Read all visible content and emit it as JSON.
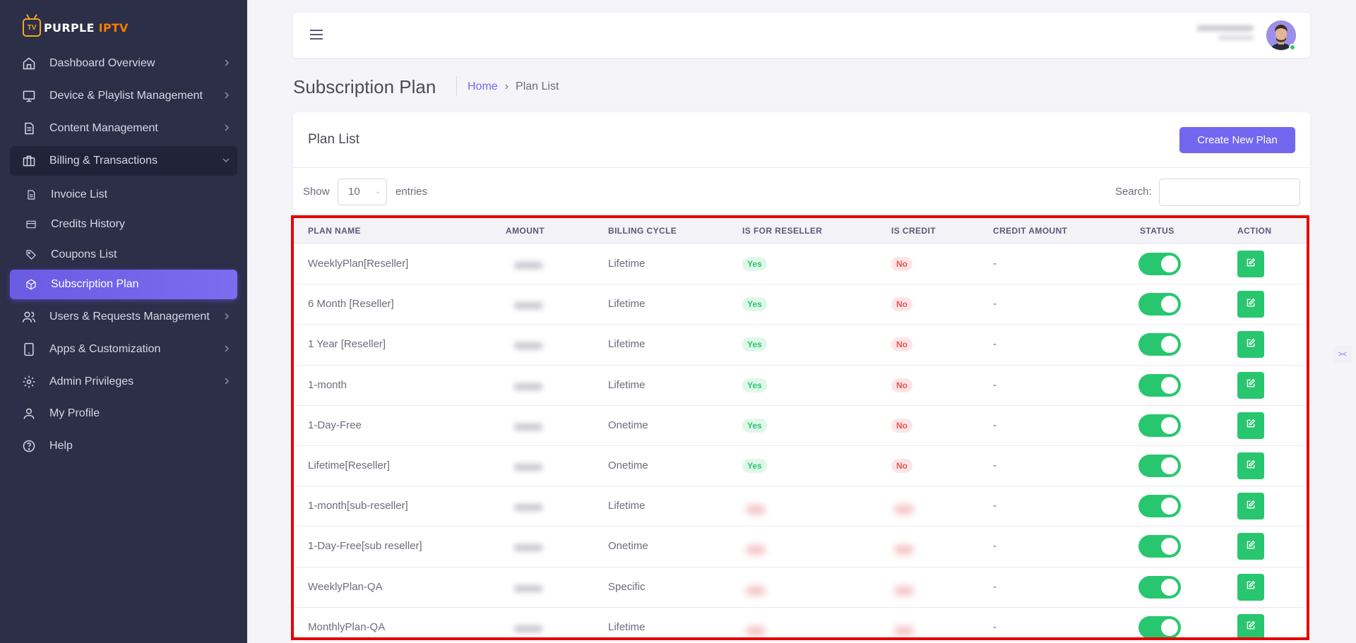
{
  "brand": {
    "name_part1": "PURPLE ",
    "name_part2": "IPTV",
    "badge": "TV"
  },
  "sidebar": {
    "items": [
      {
        "label": "Dashboard Overview",
        "icon": "home-icon"
      },
      {
        "label": "Device & Playlist Management",
        "icon": "monitor-icon"
      },
      {
        "label": "Content Management",
        "icon": "document-icon"
      },
      {
        "label": "Billing & Transactions",
        "icon": "briefcase-icon"
      },
      {
        "label": "Users & Requests Management",
        "icon": "users-icon"
      },
      {
        "label": "Apps & Customization",
        "icon": "tablet-icon"
      },
      {
        "label": "Admin Privileges",
        "icon": "gear-icon"
      },
      {
        "label": "My Profile",
        "icon": "user-icon"
      },
      {
        "label": "Help",
        "icon": "help-circle-icon"
      }
    ],
    "billing_subitems": [
      {
        "label": "Invoice List",
        "icon": "file-icon"
      },
      {
        "label": "Credits History",
        "icon": "credit-card-icon"
      },
      {
        "label": "Coupons List",
        "icon": "tag-icon"
      },
      {
        "label": "Subscription Plan",
        "icon": "box-icon"
      }
    ]
  },
  "page": {
    "title": "Subscription Plan",
    "breadcrumb_home": "Home",
    "breadcrumb_separator": "›",
    "breadcrumb_current": "Plan List"
  },
  "card": {
    "title": "Plan List",
    "create_button": "Create New Plan",
    "show_label": "Show",
    "entries_value": "10",
    "entries_label": "entries",
    "search_label": "Search:"
  },
  "table": {
    "columns": [
      "PLAN NAME",
      "AMOUNT",
      "BILLING CYCLE",
      "IS FOR RESELLER",
      "IS CREDIT",
      "CREDIT AMOUNT",
      "STATUS",
      "ACTION"
    ],
    "rows": [
      {
        "name": "WeeklyPlan[Reseller]",
        "cycle": "Lifetime",
        "reseller": "Yes",
        "credit": "No",
        "credit_amount": "-",
        "status_on": true
      },
      {
        "name": "6 Month [Reseller]",
        "cycle": "Lifetime",
        "reseller": "Yes",
        "credit": "No",
        "credit_amount": "-",
        "status_on": true
      },
      {
        "name": "1 Year [Reseller]",
        "cycle": "Lifetime",
        "reseller": "Yes",
        "credit": "No",
        "credit_amount": "-",
        "status_on": true
      },
      {
        "name": "1-month",
        "cycle": "Lifetime",
        "reseller": "Yes",
        "credit": "No",
        "credit_amount": "-",
        "status_on": true
      },
      {
        "name": "1-Day-Free",
        "cycle": "Onetime",
        "reseller": "Yes",
        "credit": "No",
        "credit_amount": "-",
        "status_on": true
      },
      {
        "name": "Lifetime[Reseller]",
        "cycle": "Onetime",
        "reseller": "Yes",
        "credit": "No",
        "credit_amount": "-",
        "status_on": true
      },
      {
        "name": "1-month[sub-reseller]",
        "cycle": "Lifetime",
        "reseller": "",
        "credit": "",
        "credit_amount": "-",
        "status_on": true
      },
      {
        "name": "1-Day-Free[sub reseller]",
        "cycle": "Onetime",
        "reseller": "",
        "credit": "",
        "credit_amount": "-",
        "status_on": true
      },
      {
        "name": "WeeklyPlan-QA",
        "cycle": "Specific",
        "reseller": "",
        "credit": "",
        "credit_amount": "-",
        "status_on": true
      },
      {
        "name": "MonthlyPlan-QA",
        "cycle": "Lifetime",
        "reseller": "",
        "credit": "",
        "credit_amount": "-",
        "status_on": true
      }
    ]
  },
  "colors": {
    "sidebar_bg": "#2b2f48",
    "accent": "#7367f0",
    "success": "#28c76f",
    "danger": "#ea5455",
    "highlight_border": "#e60000"
  }
}
